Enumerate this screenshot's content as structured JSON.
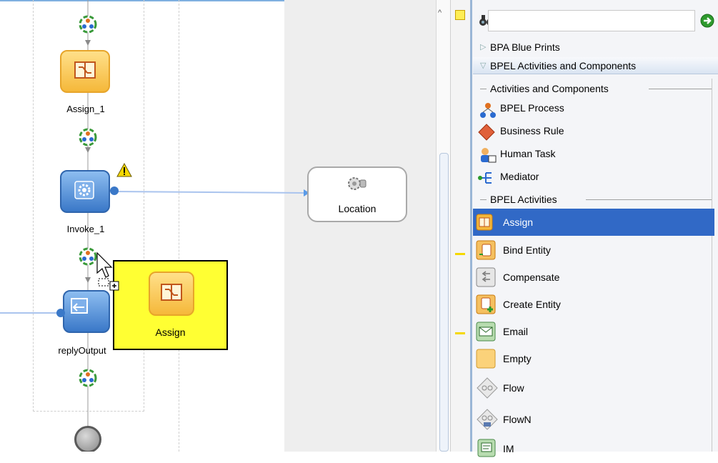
{
  "canvas": {
    "activities": [
      {
        "label": "Assign_1",
        "icon": "assign-icon"
      },
      {
        "label": "Invoke_1",
        "icon": "invoke-gear-icon"
      },
      {
        "label": "replyOutput",
        "icon": "reply-icon"
      }
    ],
    "partner_link": {
      "label": "Location",
      "icon": "service-gear-icon"
    },
    "drag_preview": {
      "label": "Assign",
      "icon": "assign-icon"
    }
  },
  "palette": {
    "search": {
      "placeholder": "",
      "value": ""
    },
    "sections": [
      {
        "label": "BPA Blue Prints",
        "expanded": false
      },
      {
        "label": "BPEL Activities and Components",
        "expanded": true
      }
    ],
    "groups": {
      "components_title": "Activities and Components",
      "activities_title": "BPEL Activities"
    },
    "components": [
      {
        "label": "BPEL Process",
        "icon": "bpel-process-icon"
      },
      {
        "label": "Business Rule",
        "icon": "business-rule-icon"
      },
      {
        "label": "Human Task",
        "icon": "human-task-icon"
      },
      {
        "label": "Mediator",
        "icon": "mediator-icon"
      }
    ],
    "activities": [
      {
        "label": "Assign",
        "icon": "assign-icon",
        "selected": true
      },
      {
        "label": "Bind Entity",
        "icon": "bind-entity-icon"
      },
      {
        "label": "Compensate",
        "icon": "compensate-icon"
      },
      {
        "label": "Create Entity",
        "icon": "create-entity-icon"
      },
      {
        "label": "Email",
        "icon": "email-icon"
      },
      {
        "label": "Empty",
        "icon": "empty-icon"
      },
      {
        "label": "Flow",
        "icon": "flow-icon"
      },
      {
        "label": "FlowN",
        "icon": "flown-icon"
      },
      {
        "label": "IM",
        "icon": "im-icon"
      }
    ]
  },
  "colors": {
    "selection": "#3169c6",
    "drag_preview_bg": "#ffff33",
    "warning": "#f5d800",
    "assign_fill": "#f5b83a",
    "invoke_fill": "#3a78c8"
  }
}
